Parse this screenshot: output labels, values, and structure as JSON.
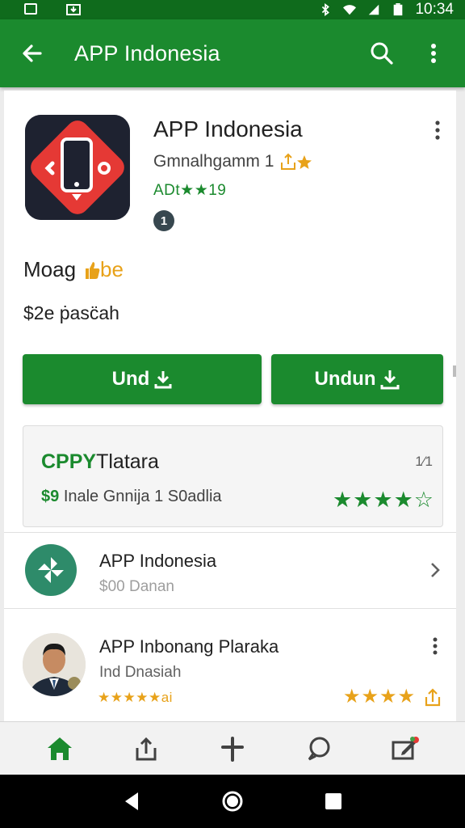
{
  "status_bar": {
    "time": "10:34",
    "icons": [
      "gallery-icon",
      "download-icon",
      "bluetooth-icon",
      "wifi-icon",
      "signal-icon",
      "battery-icon"
    ]
  },
  "app_bar": {
    "title": "APP Indonesia",
    "icons": [
      "back-arrow-icon",
      "search-icon",
      "more-vert-icon"
    ]
  },
  "app_header": {
    "name": "APP Indonesia",
    "developer": "Gmnalhgamm 1",
    "rating_text": "ADt★★19",
    "badge": "1",
    "icon_colors": {
      "background": "#1e2230",
      "diamond": "#e53935"
    }
  },
  "section": {
    "heading_prefix": "Moag",
    "heading_accent": "be",
    "price": "$2e ṗasc̈ah"
  },
  "buttons": {
    "primary_label": "Und",
    "secondary_label": "Undun"
  },
  "promo": {
    "title_green": "CPPY",
    "title_rest": "Tlatara",
    "count": "1⁄1",
    "sub_green": "$9",
    "sub_rest": "Inale Gnnija 1 S0adlia",
    "stars": "★★★★☆"
  },
  "list": [
    {
      "title": "APP Indonesia",
      "subtitle": "$00 Danan"
    },
    {
      "title": "APP Inbonang Plaraka",
      "subtitle": "Ind Dnasiah",
      "rating_text": "★★★★★ai",
      "stars": "★★★★"
    }
  ],
  "bottom_nav": [
    "home-icon",
    "share-icon",
    "add-icon",
    "chat-icon",
    "edit-icon"
  ],
  "colors": {
    "primary": "#1b8a2e",
    "primary_dark": "#0f6b1c",
    "accent": "#e8a21a"
  }
}
